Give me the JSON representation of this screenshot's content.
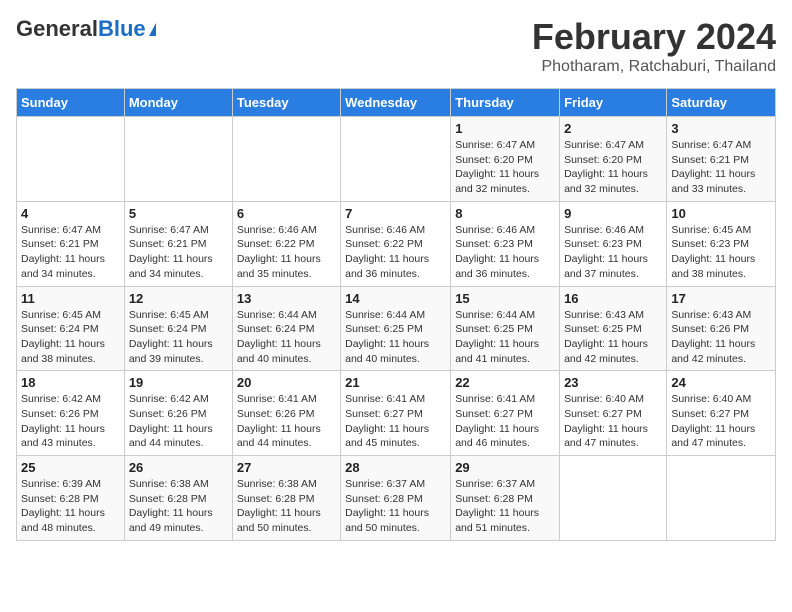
{
  "header": {
    "logo": {
      "general": "General",
      "blue": "Blue"
    },
    "title": "February 2024",
    "location": "Photharam, Ratchaburi, Thailand"
  },
  "weekdays": [
    "Sunday",
    "Monday",
    "Tuesday",
    "Wednesday",
    "Thursday",
    "Friday",
    "Saturday"
  ],
  "weeks": [
    [
      {
        "num": "",
        "info": ""
      },
      {
        "num": "",
        "info": ""
      },
      {
        "num": "",
        "info": ""
      },
      {
        "num": "",
        "info": ""
      },
      {
        "num": "1",
        "info": "Sunrise: 6:47 AM\nSunset: 6:20 PM\nDaylight: 11 hours\nand 32 minutes."
      },
      {
        "num": "2",
        "info": "Sunrise: 6:47 AM\nSunset: 6:20 PM\nDaylight: 11 hours\nand 32 minutes."
      },
      {
        "num": "3",
        "info": "Sunrise: 6:47 AM\nSunset: 6:21 PM\nDaylight: 11 hours\nand 33 minutes."
      }
    ],
    [
      {
        "num": "4",
        "info": "Sunrise: 6:47 AM\nSunset: 6:21 PM\nDaylight: 11 hours\nand 34 minutes."
      },
      {
        "num": "5",
        "info": "Sunrise: 6:47 AM\nSunset: 6:21 PM\nDaylight: 11 hours\nand 34 minutes."
      },
      {
        "num": "6",
        "info": "Sunrise: 6:46 AM\nSunset: 6:22 PM\nDaylight: 11 hours\nand 35 minutes."
      },
      {
        "num": "7",
        "info": "Sunrise: 6:46 AM\nSunset: 6:22 PM\nDaylight: 11 hours\nand 36 minutes."
      },
      {
        "num": "8",
        "info": "Sunrise: 6:46 AM\nSunset: 6:23 PM\nDaylight: 11 hours\nand 36 minutes."
      },
      {
        "num": "9",
        "info": "Sunrise: 6:46 AM\nSunset: 6:23 PM\nDaylight: 11 hours\nand 37 minutes."
      },
      {
        "num": "10",
        "info": "Sunrise: 6:45 AM\nSunset: 6:23 PM\nDaylight: 11 hours\nand 38 minutes."
      }
    ],
    [
      {
        "num": "11",
        "info": "Sunrise: 6:45 AM\nSunset: 6:24 PM\nDaylight: 11 hours\nand 38 minutes."
      },
      {
        "num": "12",
        "info": "Sunrise: 6:45 AM\nSunset: 6:24 PM\nDaylight: 11 hours\nand 39 minutes."
      },
      {
        "num": "13",
        "info": "Sunrise: 6:44 AM\nSunset: 6:24 PM\nDaylight: 11 hours\nand 40 minutes."
      },
      {
        "num": "14",
        "info": "Sunrise: 6:44 AM\nSunset: 6:25 PM\nDaylight: 11 hours\nand 40 minutes."
      },
      {
        "num": "15",
        "info": "Sunrise: 6:44 AM\nSunset: 6:25 PM\nDaylight: 11 hours\nand 41 minutes."
      },
      {
        "num": "16",
        "info": "Sunrise: 6:43 AM\nSunset: 6:25 PM\nDaylight: 11 hours\nand 42 minutes."
      },
      {
        "num": "17",
        "info": "Sunrise: 6:43 AM\nSunset: 6:26 PM\nDaylight: 11 hours\nand 42 minutes."
      }
    ],
    [
      {
        "num": "18",
        "info": "Sunrise: 6:42 AM\nSunset: 6:26 PM\nDaylight: 11 hours\nand 43 minutes."
      },
      {
        "num": "19",
        "info": "Sunrise: 6:42 AM\nSunset: 6:26 PM\nDaylight: 11 hours\nand 44 minutes."
      },
      {
        "num": "20",
        "info": "Sunrise: 6:41 AM\nSunset: 6:26 PM\nDaylight: 11 hours\nand 44 minutes."
      },
      {
        "num": "21",
        "info": "Sunrise: 6:41 AM\nSunset: 6:27 PM\nDaylight: 11 hours\nand 45 minutes."
      },
      {
        "num": "22",
        "info": "Sunrise: 6:41 AM\nSunset: 6:27 PM\nDaylight: 11 hours\nand 46 minutes."
      },
      {
        "num": "23",
        "info": "Sunrise: 6:40 AM\nSunset: 6:27 PM\nDaylight: 11 hours\nand 47 minutes."
      },
      {
        "num": "24",
        "info": "Sunrise: 6:40 AM\nSunset: 6:27 PM\nDaylight: 11 hours\nand 47 minutes."
      }
    ],
    [
      {
        "num": "25",
        "info": "Sunrise: 6:39 AM\nSunset: 6:28 PM\nDaylight: 11 hours\nand 48 minutes."
      },
      {
        "num": "26",
        "info": "Sunrise: 6:38 AM\nSunset: 6:28 PM\nDaylight: 11 hours\nand 49 minutes."
      },
      {
        "num": "27",
        "info": "Sunrise: 6:38 AM\nSunset: 6:28 PM\nDaylight: 11 hours\nand 50 minutes."
      },
      {
        "num": "28",
        "info": "Sunrise: 6:37 AM\nSunset: 6:28 PM\nDaylight: 11 hours\nand 50 minutes."
      },
      {
        "num": "29",
        "info": "Sunrise: 6:37 AM\nSunset: 6:28 PM\nDaylight: 11 hours\nand 51 minutes."
      },
      {
        "num": "",
        "info": ""
      },
      {
        "num": "",
        "info": ""
      }
    ]
  ]
}
